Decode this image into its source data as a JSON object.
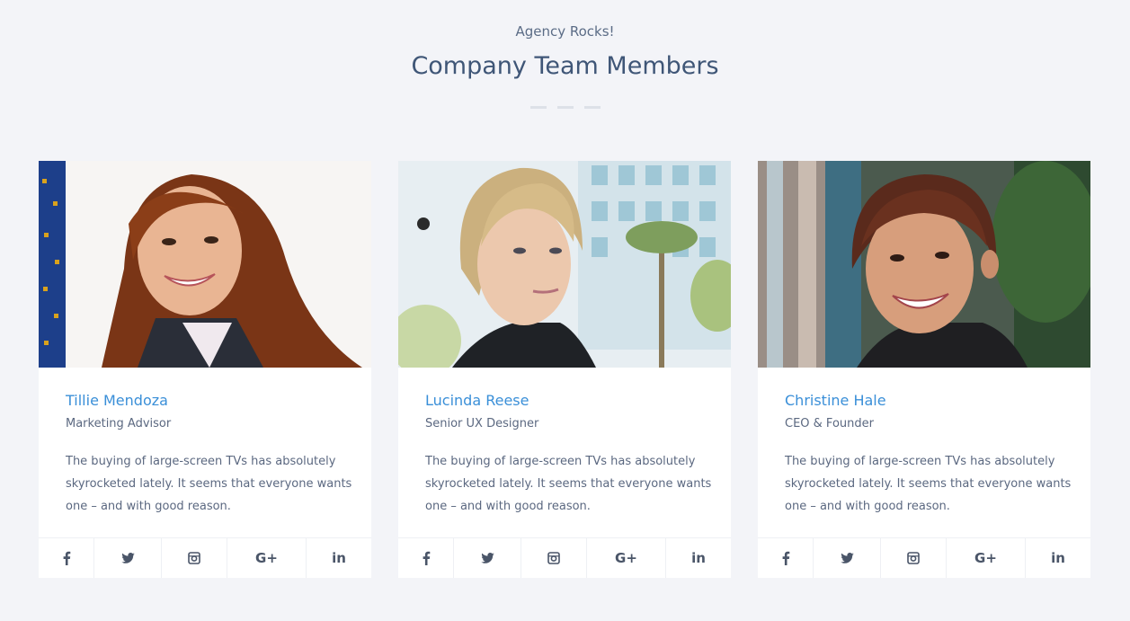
{
  "section": {
    "kicker": "Agency Rocks!",
    "title": "Company Team Members"
  },
  "members": [
    {
      "name": "Tillie Mendoza",
      "role": "Marketing Advisor",
      "bio": "The buying of large-screen TVs has absolutely skyrocketed lately. It seems that everyone wants one – and with good reason."
    },
    {
      "name": "Lucinda Reese",
      "role": "Senior UX Designer",
      "bio": "The buying of large-screen TVs has absolutely skyrocketed lately. It seems that everyone wants one – and with good reason."
    },
    {
      "name": "Christine Hale",
      "role": "CEO & Founder",
      "bio": "The buying of large-screen TVs has absolutely skyrocketed lately. It seems that everyone wants one – and with good reason."
    }
  ],
  "social": {
    "facebook": "facebook-icon",
    "twitter": "twitter-icon",
    "instagram": "instagram-icon",
    "googleplus": "G+",
    "linkedin": "in"
  },
  "colors": {
    "background": "#f3f4f8",
    "accent": "#3a8fd8",
    "heading": "#3f5677"
  }
}
